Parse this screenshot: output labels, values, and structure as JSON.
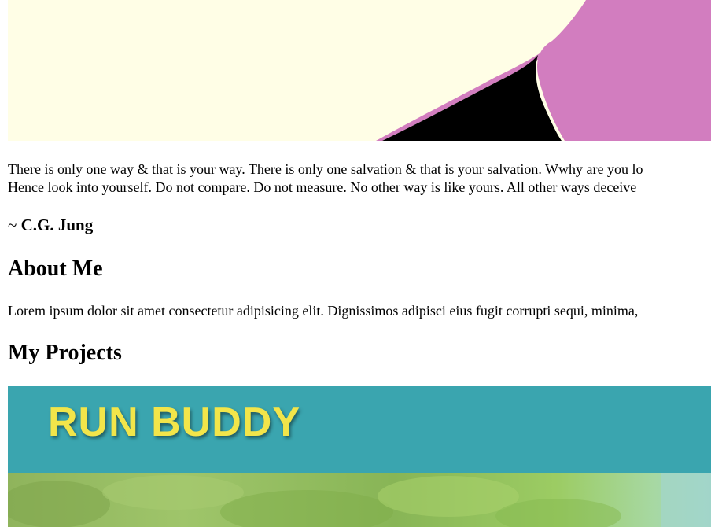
{
  "hero": {
    "colors": {
      "background": "#fffee6",
      "pink": "#d27dbf",
      "dark": "#000000"
    }
  },
  "quote": {
    "line1": "There is only one way & that is your way. There is only one salvation & that is your salvation. Wwhy are you lo",
    "line2": "Hence look into yourself. Do not compare. Do not measure. No other way is like yours. All other ways deceive"
  },
  "attribution": {
    "prefix": "~ ",
    "name": "C.G. Jung"
  },
  "about": {
    "heading": "About Me",
    "text": "Lorem ipsum dolor sit amet consectetur adipisicing elit. Dignissimos adipisci eius fugit corrupti sequi, minima,"
  },
  "projects": {
    "heading": "My Projects",
    "items": [
      {
        "title": "RUN BUDDY",
        "title_color": "#f2e54a",
        "banner_color": "#3aa5af"
      }
    ]
  }
}
